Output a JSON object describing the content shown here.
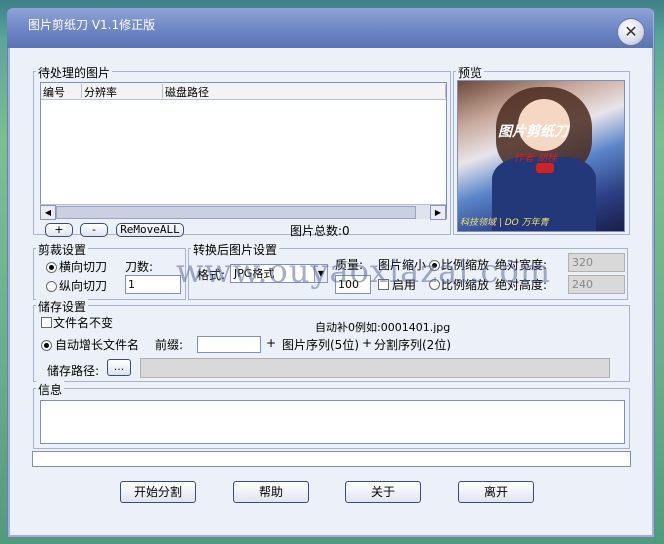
{
  "window": {
    "title": "图片剪纸刀 V1.1修正版"
  },
  "pending": {
    "group_label": "待处理的图片",
    "columns": [
      "编号",
      "分辨率",
      "磁盘路径"
    ],
    "add_label": "+",
    "remove_label": "-",
    "remove_all_label": "ReMoveALL",
    "total_label": "图片总数:0"
  },
  "preview": {
    "group_label": "预览",
    "image_text_top": "图片剪纸刀",
    "image_text_mid": "作者 胡桂",
    "image_text_bottom": "科技领域 | DO 万年青"
  },
  "cut": {
    "group_label": "剪裁设置",
    "horizontal_label": "横向切刀",
    "vertical_label": "纵向切刀",
    "knife_label": "刀数:",
    "knife_value": "1",
    "selected": "horizontal"
  },
  "convert": {
    "group_label": "转换后图片设置",
    "format_label": "格式:",
    "format_value": "JPG格式",
    "quality_label": "质量:",
    "quality_value": "100",
    "scale_label": "图片缩小",
    "enable_label": "启用",
    "ratio_label": "比例缩放",
    "ratio_label_2": "比例缩放",
    "abs_width_label": "绝对宽度:",
    "abs_width_value": "320",
    "abs_height_label": "绝对高度:",
    "abs_height_value": "240"
  },
  "save": {
    "group_label": "储存设置",
    "keep_name_label": "文件名不变",
    "auto_name_label": "自动增长文件名",
    "prefix_label": "前缀:",
    "plus1": "+",
    "seq_label": "图片序列(5位)",
    "plus2": "+",
    "split_label": "分割序列(2位)",
    "example_text": "自动补0例如:0001401.jpg",
    "path_label": "储存路径:",
    "browse_label": "...",
    "path_value": ""
  },
  "info": {
    "group_label": "信息"
  },
  "buttons": {
    "start": "开始分割",
    "help": "帮助",
    "about": "关于",
    "exit": "离开"
  },
  "watermark": "www.ouyaoxiazai.com"
}
